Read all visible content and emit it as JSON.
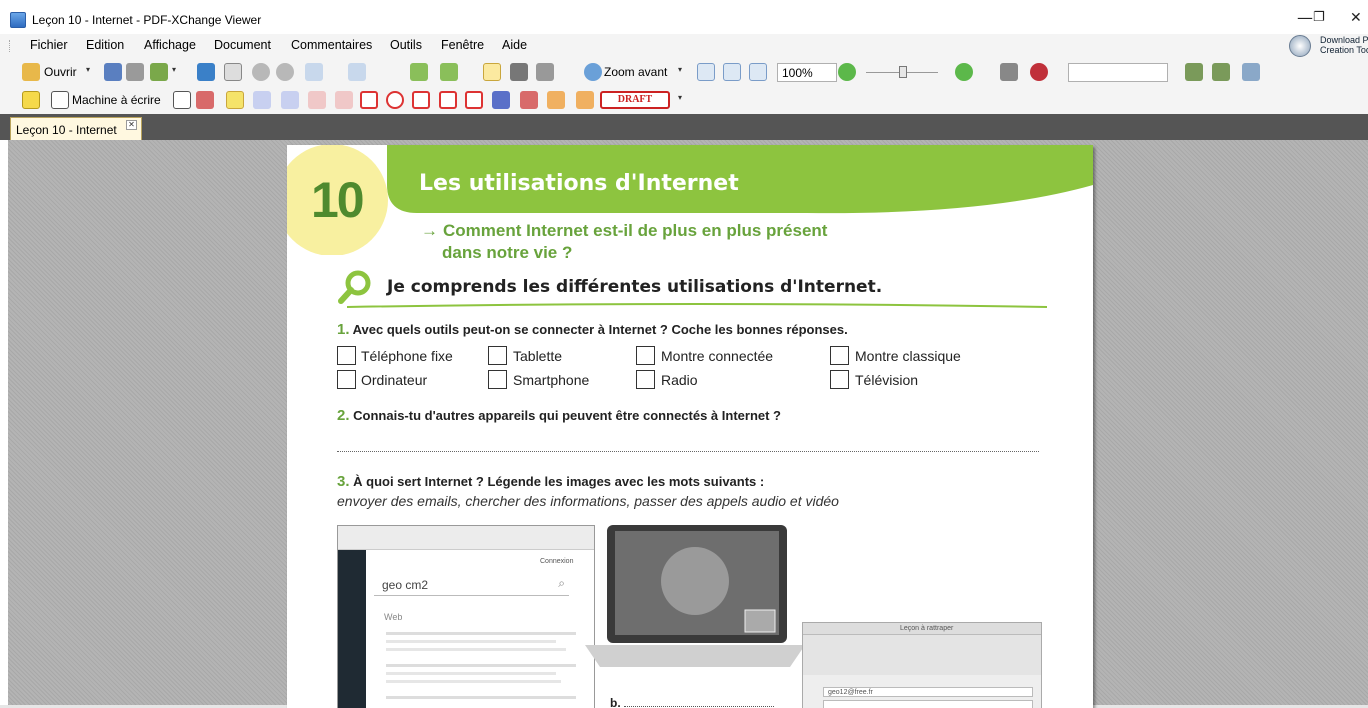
{
  "window": {
    "title": "Leçon 10 - Internet - PDF-XChange Viewer",
    "minimize": "—",
    "restore": "❐",
    "close": "✕"
  },
  "menu": [
    "Fichier",
    "Edition",
    "Affichage",
    "Document",
    "Commentaires",
    "Outils",
    "Fenêtre",
    "Aide"
  ],
  "download": {
    "line1": "Download P",
    "line2": "Creation Too"
  },
  "toolbar1": {
    "open_label": "Ouvrir",
    "zoom_in_label": "Zoom avant",
    "zoom_level": "100%",
    "dropdown": "▾"
  },
  "toolbar2": {
    "typewriter_label": "Machine à écrire",
    "stamp_label": "DRAFT"
  },
  "tab": {
    "label": "Leçon 10 - Internet",
    "close": "✕"
  },
  "document": {
    "lesson_number": "10",
    "lesson_title": "Les utilisations d'Internet",
    "subtitle_arrow": "→",
    "subtitle_line1": "Comment Internet est-il de plus en plus présent",
    "subtitle_line2": "dans notre vie ?",
    "section_heading": "Je comprends les différentes utilisations d'Internet.",
    "q1_num": "1.",
    "q1_text": "Avec quels outils peut-on se connecter à Internet ? Coche les bonnes réponses.",
    "options": [
      "Téléphone fixe",
      "Tablette",
      "Montre connectée",
      "Montre classique",
      "Ordinateur",
      "Smartphone",
      "Radio",
      "Télévision"
    ],
    "q2_num": "2.",
    "q2_text": "Connais-tu d'autres appareils qui peuvent être connectés à Internet ?",
    "q3_num": "3.",
    "q3_text": "À quoi sert Internet ? Légende les images avec les mots suivants :",
    "q3_words": "envoyer des emails, chercher des informations, passer des appels audio et vidéo",
    "search_query": "geo cm2",
    "search_tab": "Web",
    "connexion": "Connexion",
    "mail_title": "Leçon à rattraper",
    "mail_to": "geo12@free.fr",
    "b_label": "b."
  },
  "colors": {
    "accent_green": "#8dc43f",
    "title_green": "#68a33c",
    "lesson_yellow": "#f8f0a0"
  }
}
